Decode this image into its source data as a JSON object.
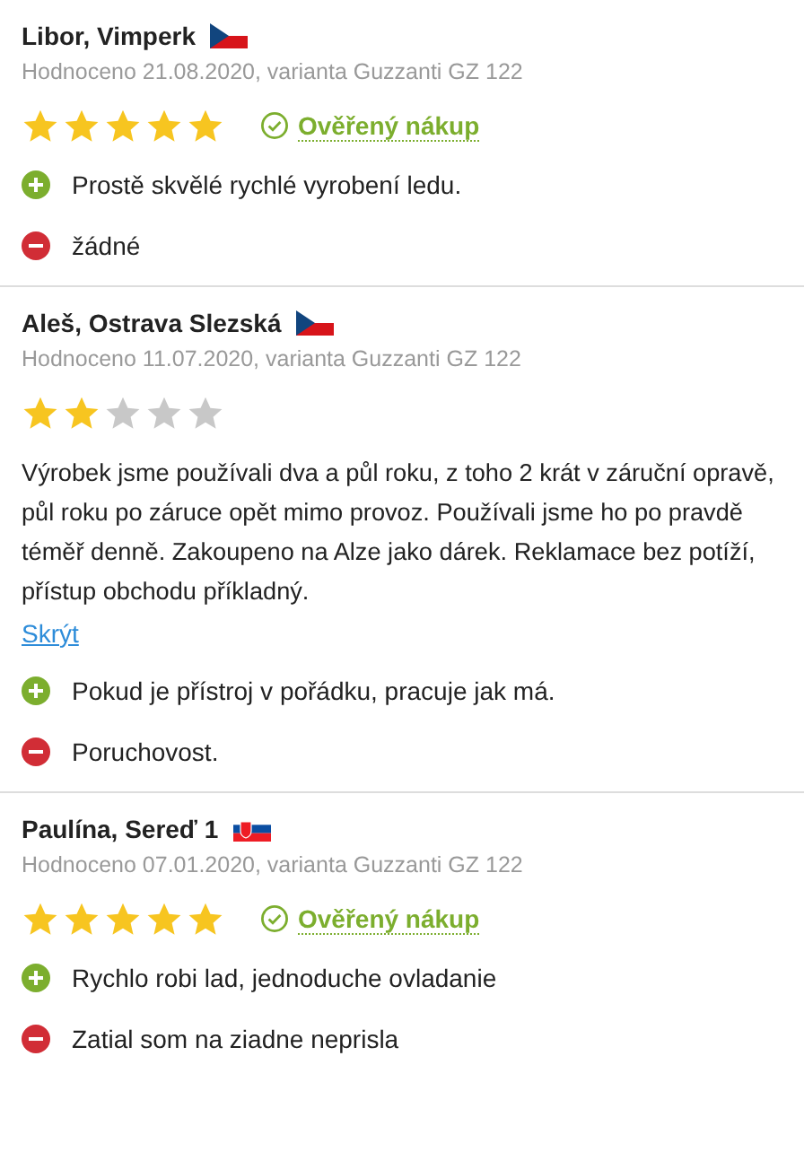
{
  "reviews": [
    {
      "author": "Libor, Vimperk",
      "flag": {
        "kind": "cz"
      },
      "meta": "Hodnoceno 21.08.2020, varianta Guzzanti GZ 122",
      "stars": 5,
      "verified": true,
      "verified_label": "Ověřený nákup",
      "pros": [
        "Prostě skvělé rychlé vyrobení ledu."
      ],
      "cons": [
        "žádné"
      ]
    },
    {
      "author": "Aleš, Ostrava Slezská",
      "flag": {
        "kind": "cz"
      },
      "meta": "Hodnoceno 11.07.2020, varianta Guzzanti GZ 122",
      "stars": 2,
      "verified": false,
      "text": "Výrobek jsme používali dva a půl roku, z toho 2 krát v záruční opravě, půl roku po záruce opět mimo provoz. Používali jsme ho po pravdě téměř denně. Zakoupeno na Alze jako dárek. Reklamace bez potíží, přístup obchodu příkladný.",
      "hide_link": "Skrýt",
      "pros": [
        "Pokud je přístroj v pořádku, pracuje jak má."
      ],
      "cons": [
        "Poruchovost."
      ]
    },
    {
      "author": "Paulína, Sereď 1",
      "flag": {
        "kind": "sk"
      },
      "meta": "Hodnoceno 07.01.2020, varianta Guzzanti GZ 122",
      "stars": 5,
      "verified": true,
      "verified_label": "Ověřený nákup",
      "pros": [
        "Rychlo robi lad, jednoduche ovladanie"
      ],
      "cons": [
        "Zatial som na ziadne neprisla"
      ]
    }
  ]
}
